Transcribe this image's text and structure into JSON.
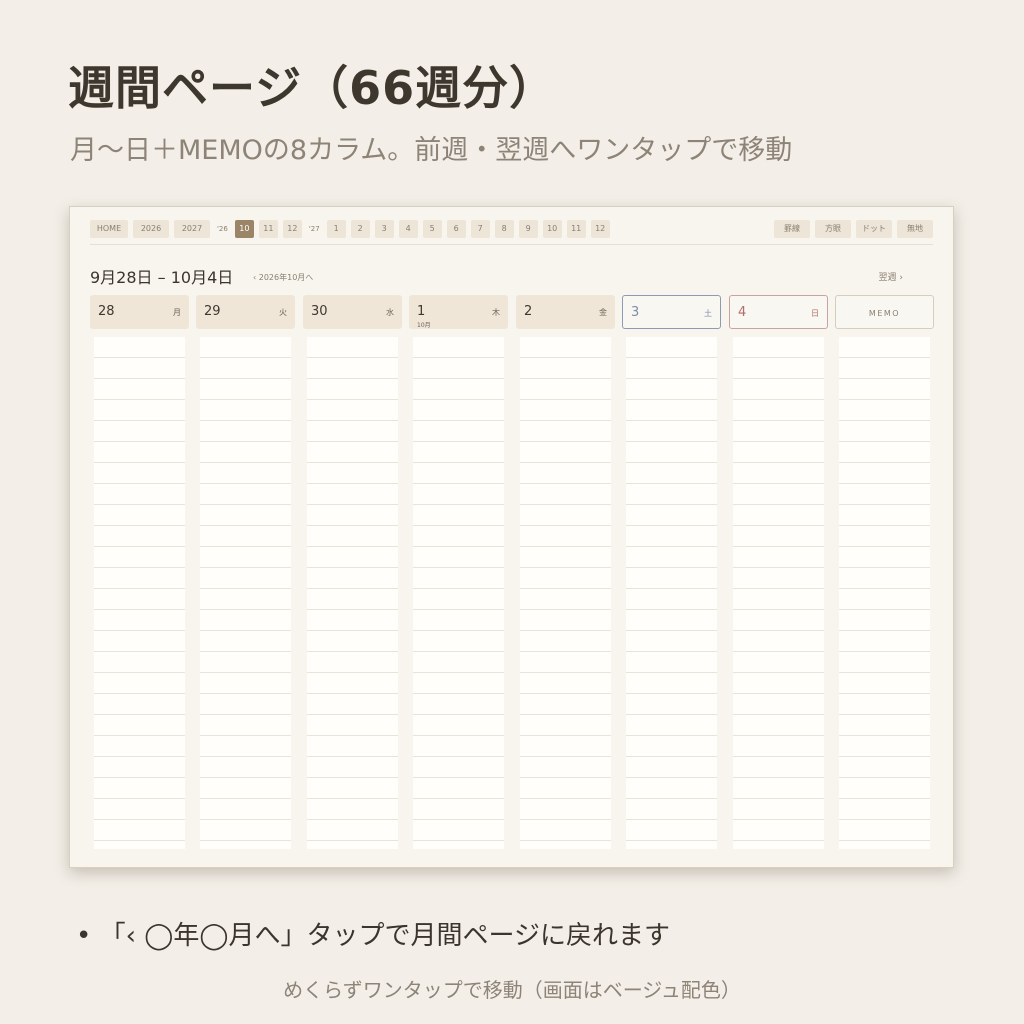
{
  "heading": {
    "title": "週間ページ（66週分）",
    "subtitle": "月〜日＋MEMOの8カラム。前週・翌週へワンタップで移動"
  },
  "planner": {
    "nav": {
      "home": "HOME",
      "years": [
        "2026",
        "2027"
      ],
      "year_label_26": "'26",
      "months_26": [
        "10",
        "11",
        "12"
      ],
      "active_month": "10",
      "year_label_27": "'27",
      "months_27": [
        "1",
        "2",
        "3",
        "4",
        "5",
        "6",
        "7",
        "8",
        "9",
        "10",
        "11",
        "12"
      ],
      "styles": [
        "罫線",
        "方眼",
        "ドット",
        "無地"
      ]
    },
    "range": "9月28日 – 10月4日",
    "back_link": "‹ 2026年10月へ",
    "next_link": "翌週 ›",
    "days": [
      {
        "date": "28",
        "weekday": "月",
        "month_note": ""
      },
      {
        "date": "29",
        "weekday": "火",
        "month_note": ""
      },
      {
        "date": "30",
        "weekday": "水",
        "month_note": ""
      },
      {
        "date": "1",
        "weekday": "木",
        "month_note": "10月"
      },
      {
        "date": "2",
        "weekday": "金",
        "month_note": ""
      },
      {
        "date": "3",
        "weekday": "土",
        "month_note": ""
      },
      {
        "date": "4",
        "weekday": "日",
        "month_note": ""
      }
    ],
    "memo_label": "MEMO"
  },
  "bullet": "•  「‹ ◯年◯月へ」タップで月間ページに戻れます",
  "caption": "めくらずワンタップで移動（画面はベージュ配色）",
  "colors": {
    "background": "#f3efe8",
    "accent": "#9b8566",
    "saturday": "#7d8fa8",
    "sunday": "#b06e66"
  }
}
